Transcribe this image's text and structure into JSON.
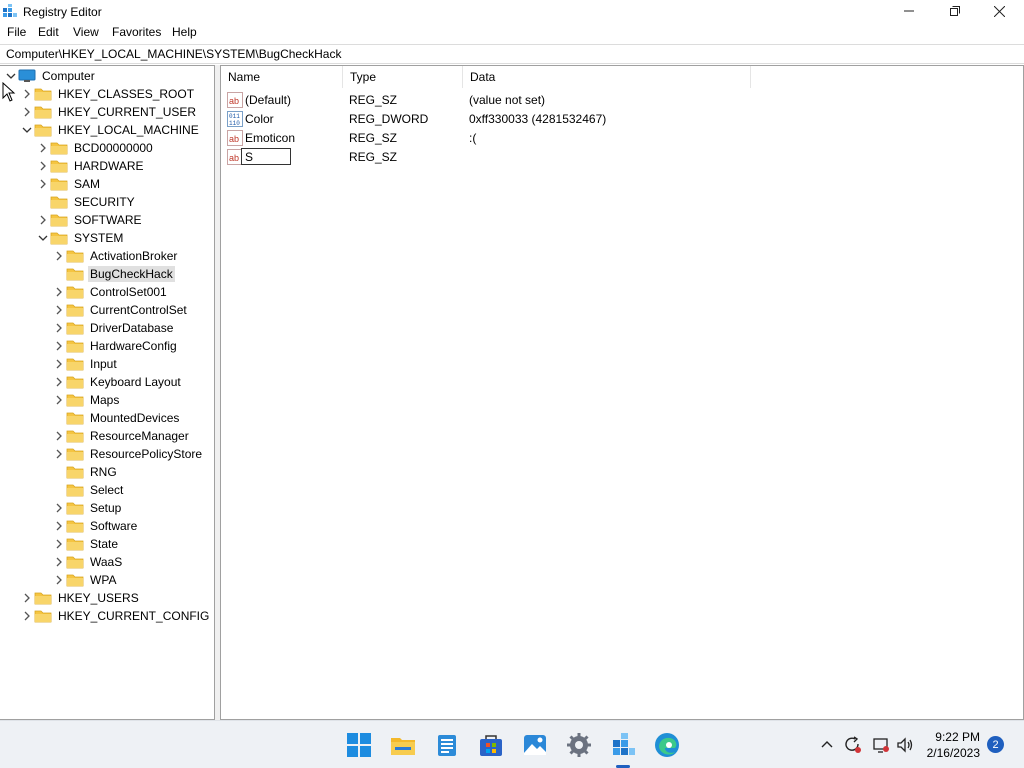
{
  "window": {
    "title": "Registry Editor"
  },
  "menu": [
    "File",
    "Edit",
    "View",
    "Favorites",
    "Help"
  ],
  "address": "Computer\\HKEY_LOCAL_MACHINE\\SYSTEM\\BugCheckHack",
  "tree": [
    {
      "label": "Computer",
      "level": 0,
      "expanded": true,
      "icon": "computer-icon"
    },
    {
      "label": "HKEY_CLASSES_ROOT",
      "level": 1,
      "expanded": false
    },
    {
      "label": "HKEY_CURRENT_USER",
      "level": 1,
      "expanded": false
    },
    {
      "label": "HKEY_LOCAL_MACHINE",
      "level": 1,
      "expanded": true
    },
    {
      "label": "BCD00000000",
      "level": 2,
      "expanded": false
    },
    {
      "label": "HARDWARE",
      "level": 2,
      "expanded": false
    },
    {
      "label": "SAM",
      "level": 2,
      "expanded": false
    },
    {
      "label": "SECURITY",
      "level": 2,
      "leaf": true
    },
    {
      "label": "SOFTWARE",
      "level": 2,
      "expanded": false
    },
    {
      "label": "SYSTEM",
      "level": 2,
      "expanded": true
    },
    {
      "label": "ActivationBroker",
      "level": 3,
      "expanded": false
    },
    {
      "label": "BugCheckHack",
      "level": 3,
      "leaf": true,
      "selected": true
    },
    {
      "label": "ControlSet001",
      "level": 3,
      "expanded": false
    },
    {
      "label": "CurrentControlSet",
      "level": 3,
      "expanded": false
    },
    {
      "label": "DriverDatabase",
      "level": 3,
      "expanded": false
    },
    {
      "label": "HardwareConfig",
      "level": 3,
      "expanded": false
    },
    {
      "label": "Input",
      "level": 3,
      "expanded": false
    },
    {
      "label": "Keyboard Layout",
      "level": 3,
      "expanded": false
    },
    {
      "label": "Maps",
      "level": 3,
      "expanded": false
    },
    {
      "label": "MountedDevices",
      "level": 3,
      "leaf": true
    },
    {
      "label": "ResourceManager",
      "level": 3,
      "expanded": false
    },
    {
      "label": "ResourcePolicyStore",
      "level": 3,
      "expanded": false
    },
    {
      "label": "RNG",
      "level": 3,
      "leaf": true
    },
    {
      "label": "Select",
      "level": 3,
      "leaf": true
    },
    {
      "label": "Setup",
      "level": 3,
      "expanded": false
    },
    {
      "label": "Software",
      "level": 3,
      "expanded": false
    },
    {
      "label": "State",
      "level": 3,
      "expanded": false
    },
    {
      "label": "WaaS",
      "level": 3,
      "expanded": false
    },
    {
      "label": "WPA",
      "level": 3,
      "expanded": false
    },
    {
      "label": "HKEY_USERS",
      "level": 1,
      "expanded": false
    },
    {
      "label": "HKEY_CURRENT_CONFIG",
      "level": 1,
      "expanded": false
    }
  ],
  "list": {
    "columns": {
      "name": "Name",
      "type": "Type",
      "data": "Data"
    },
    "rows": [
      {
        "name": "(Default)",
        "type": "REG_SZ",
        "data": "(value not set)",
        "icon": "string-value-icon"
      },
      {
        "name": "Color",
        "type": "REG_DWORD",
        "data": "0xff330033 (4281532467)",
        "icon": "binary-value-icon"
      },
      {
        "name": "Emoticon",
        "type": "REG_SZ",
        "data": ":(",
        "icon": "string-value-icon"
      },
      {
        "name": "S",
        "type": "REG_SZ",
        "data": "",
        "icon": "string-value-icon",
        "editing": true
      }
    ]
  },
  "taskbar": {
    "apps": [
      "start-icon",
      "file-explorer-icon",
      "notepad-icon",
      "store-icon",
      "photos-icon",
      "settings-icon",
      "registry-editor-icon",
      "edge-icon"
    ],
    "clock_time": "9:22 PM",
    "clock_date": "2/16/2023",
    "notification_count": "2"
  },
  "colors": {
    "folder": "#f5c542",
    "accent": "#1f5fbf",
    "taskbar": "#eef1f5"
  }
}
